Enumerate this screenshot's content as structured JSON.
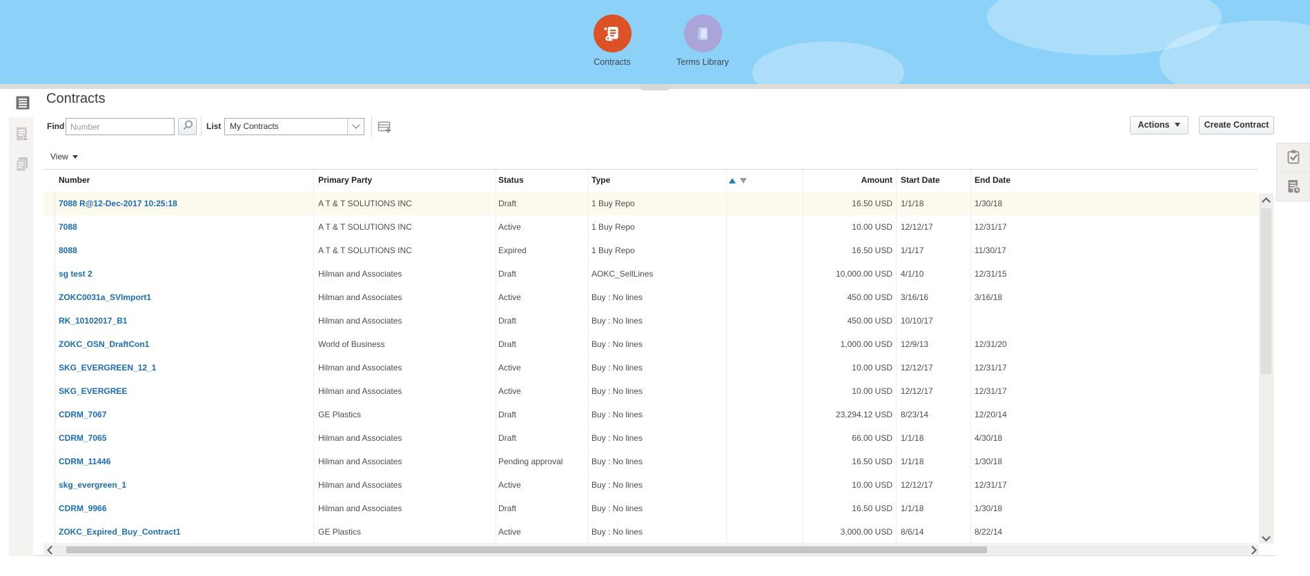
{
  "banner": {
    "apps": [
      {
        "label": "Contracts",
        "circle_color": "#DD5127",
        "icon": "contracts-scroll-icon"
      },
      {
        "label": "Terms Library",
        "circle_color": "#A9A5D9",
        "icon": "terms-library-book-icon"
      }
    ],
    "background_color": "#8CD2F8"
  },
  "toolbar": {
    "page_title": "Contracts",
    "find_label": "Find",
    "find_placeholder": "Number",
    "list_label": "List",
    "list_value": "My Contracts",
    "actions_label": "Actions",
    "create_contract_label": "Create Contract",
    "view_label": "View"
  },
  "table": {
    "columns": [
      "Number",
      "Primary Party",
      "Status",
      "Type",
      "Amount",
      "Start Date",
      "End Date"
    ],
    "sorted_column": "Type",
    "row_count": 15,
    "highlight_color": "#FBFAEC",
    "link_color": "#1A6CB4",
    "rows": [
      {
        "number": "7088 R@12-Dec-2017 10:25:18",
        "primary_party": "A T & T SOLUTIONS INC",
        "status": "Draft",
        "type": "1 Buy Repo",
        "amount": "16.50 USD",
        "start_date": "1/1/18",
        "end_date": "1/30/18",
        "highlighted": true
      },
      {
        "number": "7088",
        "primary_party": "A T & T SOLUTIONS INC",
        "status": "Active",
        "type": "1 Buy Repo",
        "amount": "10.00 USD",
        "start_date": "12/12/17",
        "end_date": "12/31/17",
        "highlighted": false
      },
      {
        "number": "8088",
        "primary_party": "A T & T SOLUTIONS INC",
        "status": "Expired",
        "type": "1 Buy Repo",
        "amount": "16.50 USD",
        "start_date": "1/1/17",
        "end_date": "11/30/17",
        "highlighted": false
      },
      {
        "number": "sg test 2",
        "primary_party": "Hilman and Associates",
        "status": "Draft",
        "type": "AOKC_SellLines",
        "amount": "10,000.00 USD",
        "start_date": "4/1/10",
        "end_date": "12/31/15",
        "highlighted": false
      },
      {
        "number": "ZOKC0031a_SVImport1",
        "primary_party": "Hilman and Associates",
        "status": "Active",
        "type": "Buy : No lines",
        "amount": "450.00 USD",
        "start_date": "3/16/16",
        "end_date": "3/16/18",
        "highlighted": false
      },
      {
        "number": "RK_10102017_B1",
        "primary_party": "Hilman and Associates",
        "status": "Draft",
        "type": "Buy : No lines",
        "amount": "450.00 USD",
        "start_date": "10/10/17",
        "end_date": "",
        "highlighted": false
      },
      {
        "number": "ZOKC_OSN_DraftCon1",
        "primary_party": "World of Business",
        "status": "Draft",
        "type": "Buy : No lines",
        "amount": "1,000.00 USD",
        "start_date": "12/9/13",
        "end_date": "12/31/20",
        "highlighted": false
      },
      {
        "number": "SKG_EVERGREEN_12_1",
        "primary_party": "Hilman and Associates",
        "status": "Active",
        "type": "Buy : No lines",
        "amount": "10.00 USD",
        "start_date": "12/12/17",
        "end_date": "12/31/17",
        "highlighted": false
      },
      {
        "number": "SKG_EVERGREE",
        "primary_party": "Hilman and Associates",
        "status": "Active",
        "type": "Buy : No lines",
        "amount": "10.00 USD",
        "start_date": "12/12/17",
        "end_date": "12/31/17",
        "highlighted": false
      },
      {
        "number": "CDRM_7067",
        "primary_party": "GE Plastics",
        "status": "Draft",
        "type": "Buy : No lines",
        "amount": "23,294.12 USD",
        "start_date": "8/23/14",
        "end_date": "12/20/14",
        "highlighted": false
      },
      {
        "number": "CDRM_7065",
        "primary_party": "Hilman and Associates",
        "status": "Draft",
        "type": "Buy : No lines",
        "amount": "66.00 USD",
        "start_date": "1/1/18",
        "end_date": "4/30/18",
        "highlighted": false
      },
      {
        "number": "CDRM_11446",
        "primary_party": "Hilman and Associates",
        "status": "Pending approval",
        "type": "Buy : No lines",
        "amount": "16.50 USD",
        "start_date": "1/1/18",
        "end_date": "1/30/18",
        "highlighted": false
      },
      {
        "number": "skg_evergreen_1",
        "primary_party": "Hilman and Associates",
        "status": "Active",
        "type": "Buy : No lines",
        "amount": "10.00 USD",
        "start_date": "12/12/17",
        "end_date": "12/31/17",
        "highlighted": false
      },
      {
        "number": "CDRM_9966",
        "primary_party": "Hilman and Associates",
        "status": "Draft",
        "type": "Buy : No lines",
        "amount": "16.50 USD",
        "start_date": "1/1/18",
        "end_date": "1/30/18",
        "highlighted": false
      },
      {
        "number": "ZOKC_Expired_Buy_Contract1",
        "primary_party": "GE Plastics",
        "status": "Active",
        "type": "Buy : No lines",
        "amount": "3,000.00 USD",
        "start_date": "8/6/14",
        "end_date": "8/22/14",
        "highlighted": false
      }
    ]
  }
}
